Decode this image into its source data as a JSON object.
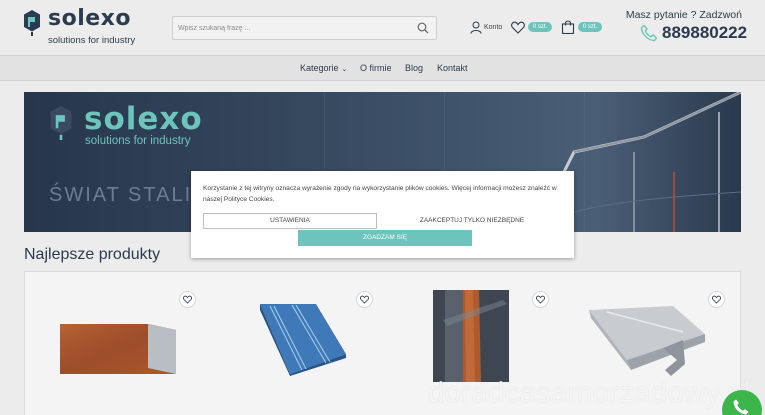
{
  "header": {
    "logo_text": "solexo",
    "logo_tagline": "solutions for industry",
    "search_placeholder": "Wpisz szukaną frazę ...",
    "account_label": "Konto",
    "wishlist_badge": "0 szt.",
    "cart_badge": "0 szt.",
    "question": "Masz pytanie ? Zadzwoń",
    "phone": "889880222"
  },
  "nav": {
    "items": [
      "Kategorie",
      "O firmie",
      "Blog",
      "Kontakt"
    ]
  },
  "banner": {
    "logo_text": "solexo",
    "tagline": "solutions for industry",
    "title": "ŚWIAT STALI N"
  },
  "section": {
    "title": "Najlepsze produkty"
  },
  "cookie": {
    "text": "Korzystanie z tej witryny oznacza wyrażenie zgody na wykorzystanie plików cookies. Więcej informacji możesz znaleźć w naszej Polityce Cookies.",
    "settings_label": "USTAWIENIA",
    "necessary_label": "ZAAKCEPTUJ TYLKO NIEZBĘDNE",
    "agree_label": "ZGADZAM SIĘ"
  },
  "watermark": "doradcasamorzadowy.pl",
  "colors": {
    "accent": "#6cc4bc",
    "navy": "#2b3c50",
    "call_green": "#3cb54a"
  },
  "icons": [
    "search-icon",
    "user-icon",
    "heart-icon",
    "cart-icon",
    "phone-icon",
    "chevron-down-icon"
  ]
}
